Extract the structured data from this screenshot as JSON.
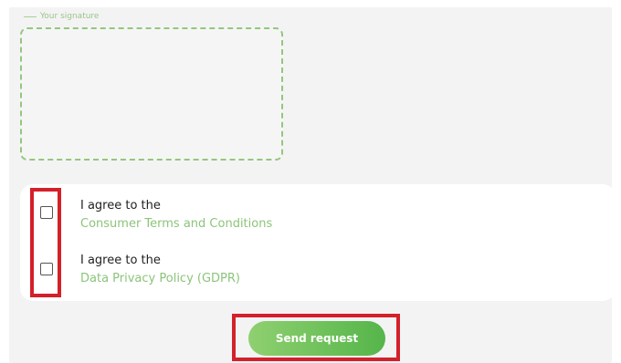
{
  "signature": {
    "legend": "Your signature"
  },
  "consents": [
    {
      "prefix": "I agree to the",
      "link": "Consumer Terms and Conditions",
      "checked": false
    },
    {
      "prefix": "I agree to the",
      "link": "Data Privacy Policy (GDPR)",
      "checked": false
    }
  ],
  "submit": {
    "label": "Send request"
  },
  "colors": {
    "accent_green": "#8cc47a",
    "button_gradient_start": "#8fd070",
    "button_gradient_end": "#55b54a",
    "highlight_red": "#d3202b",
    "panel_bg": "#f3f3f4"
  },
  "icons": {
    "checkbox": "empty-square"
  }
}
